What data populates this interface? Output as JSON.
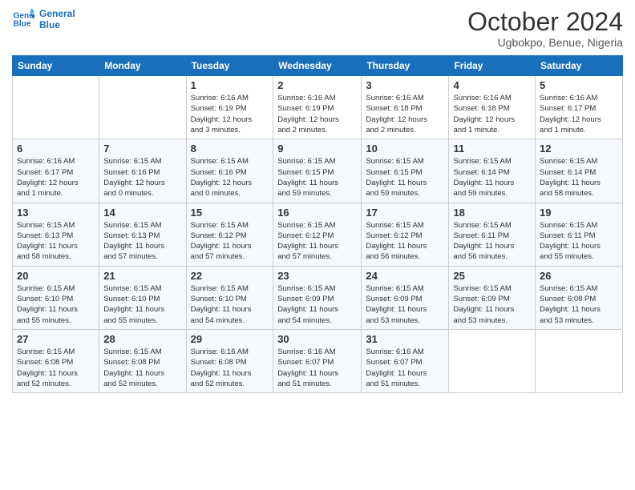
{
  "header": {
    "logo_line1": "General",
    "logo_line2": "Blue",
    "month": "October 2024",
    "location": "Ugbokpo, Benue, Nigeria"
  },
  "weekdays": [
    "Sunday",
    "Monday",
    "Tuesday",
    "Wednesday",
    "Thursday",
    "Friday",
    "Saturday"
  ],
  "weeks": [
    [
      {
        "day": "",
        "info": ""
      },
      {
        "day": "",
        "info": ""
      },
      {
        "day": "1",
        "info": "Sunrise: 6:16 AM\nSunset: 6:19 PM\nDaylight: 12 hours\nand 3 minutes."
      },
      {
        "day": "2",
        "info": "Sunrise: 6:16 AM\nSunset: 6:19 PM\nDaylight: 12 hours\nand 2 minutes."
      },
      {
        "day": "3",
        "info": "Sunrise: 6:16 AM\nSunset: 6:18 PM\nDaylight: 12 hours\nand 2 minutes."
      },
      {
        "day": "4",
        "info": "Sunrise: 6:16 AM\nSunset: 6:18 PM\nDaylight: 12 hours\nand 1 minute."
      },
      {
        "day": "5",
        "info": "Sunrise: 6:16 AM\nSunset: 6:17 PM\nDaylight: 12 hours\nand 1 minute."
      }
    ],
    [
      {
        "day": "6",
        "info": "Sunrise: 6:16 AM\nSunset: 6:17 PM\nDaylight: 12 hours\nand 1 minute."
      },
      {
        "day": "7",
        "info": "Sunrise: 6:15 AM\nSunset: 6:16 PM\nDaylight: 12 hours\nand 0 minutes."
      },
      {
        "day": "8",
        "info": "Sunrise: 6:15 AM\nSunset: 6:16 PM\nDaylight: 12 hours\nand 0 minutes."
      },
      {
        "day": "9",
        "info": "Sunrise: 6:15 AM\nSunset: 6:15 PM\nDaylight: 11 hours\nand 59 minutes."
      },
      {
        "day": "10",
        "info": "Sunrise: 6:15 AM\nSunset: 6:15 PM\nDaylight: 11 hours\nand 59 minutes."
      },
      {
        "day": "11",
        "info": "Sunrise: 6:15 AM\nSunset: 6:14 PM\nDaylight: 11 hours\nand 59 minutes."
      },
      {
        "day": "12",
        "info": "Sunrise: 6:15 AM\nSunset: 6:14 PM\nDaylight: 11 hours\nand 58 minutes."
      }
    ],
    [
      {
        "day": "13",
        "info": "Sunrise: 6:15 AM\nSunset: 6:13 PM\nDaylight: 11 hours\nand 58 minutes."
      },
      {
        "day": "14",
        "info": "Sunrise: 6:15 AM\nSunset: 6:13 PM\nDaylight: 11 hours\nand 57 minutes."
      },
      {
        "day": "15",
        "info": "Sunrise: 6:15 AM\nSunset: 6:12 PM\nDaylight: 11 hours\nand 57 minutes."
      },
      {
        "day": "16",
        "info": "Sunrise: 6:15 AM\nSunset: 6:12 PM\nDaylight: 11 hours\nand 57 minutes."
      },
      {
        "day": "17",
        "info": "Sunrise: 6:15 AM\nSunset: 6:12 PM\nDaylight: 11 hours\nand 56 minutes."
      },
      {
        "day": "18",
        "info": "Sunrise: 6:15 AM\nSunset: 6:11 PM\nDaylight: 11 hours\nand 56 minutes."
      },
      {
        "day": "19",
        "info": "Sunrise: 6:15 AM\nSunset: 6:11 PM\nDaylight: 11 hours\nand 55 minutes."
      }
    ],
    [
      {
        "day": "20",
        "info": "Sunrise: 6:15 AM\nSunset: 6:10 PM\nDaylight: 11 hours\nand 55 minutes."
      },
      {
        "day": "21",
        "info": "Sunrise: 6:15 AM\nSunset: 6:10 PM\nDaylight: 11 hours\nand 55 minutes."
      },
      {
        "day": "22",
        "info": "Sunrise: 6:15 AM\nSunset: 6:10 PM\nDaylight: 11 hours\nand 54 minutes."
      },
      {
        "day": "23",
        "info": "Sunrise: 6:15 AM\nSunset: 6:09 PM\nDaylight: 11 hours\nand 54 minutes."
      },
      {
        "day": "24",
        "info": "Sunrise: 6:15 AM\nSunset: 6:09 PM\nDaylight: 11 hours\nand 53 minutes."
      },
      {
        "day": "25",
        "info": "Sunrise: 6:15 AM\nSunset: 6:09 PM\nDaylight: 11 hours\nand 53 minutes."
      },
      {
        "day": "26",
        "info": "Sunrise: 6:15 AM\nSunset: 6:08 PM\nDaylight: 11 hours\nand 53 minutes."
      }
    ],
    [
      {
        "day": "27",
        "info": "Sunrise: 6:15 AM\nSunset: 6:08 PM\nDaylight: 11 hours\nand 52 minutes."
      },
      {
        "day": "28",
        "info": "Sunrise: 6:15 AM\nSunset: 6:08 PM\nDaylight: 11 hours\nand 52 minutes."
      },
      {
        "day": "29",
        "info": "Sunrise: 6:16 AM\nSunset: 6:08 PM\nDaylight: 11 hours\nand 52 minutes."
      },
      {
        "day": "30",
        "info": "Sunrise: 6:16 AM\nSunset: 6:07 PM\nDaylight: 11 hours\nand 51 minutes."
      },
      {
        "day": "31",
        "info": "Sunrise: 6:16 AM\nSunset: 6:07 PM\nDaylight: 11 hours\nand 51 minutes."
      },
      {
        "day": "",
        "info": ""
      },
      {
        "day": "",
        "info": ""
      }
    ]
  ]
}
